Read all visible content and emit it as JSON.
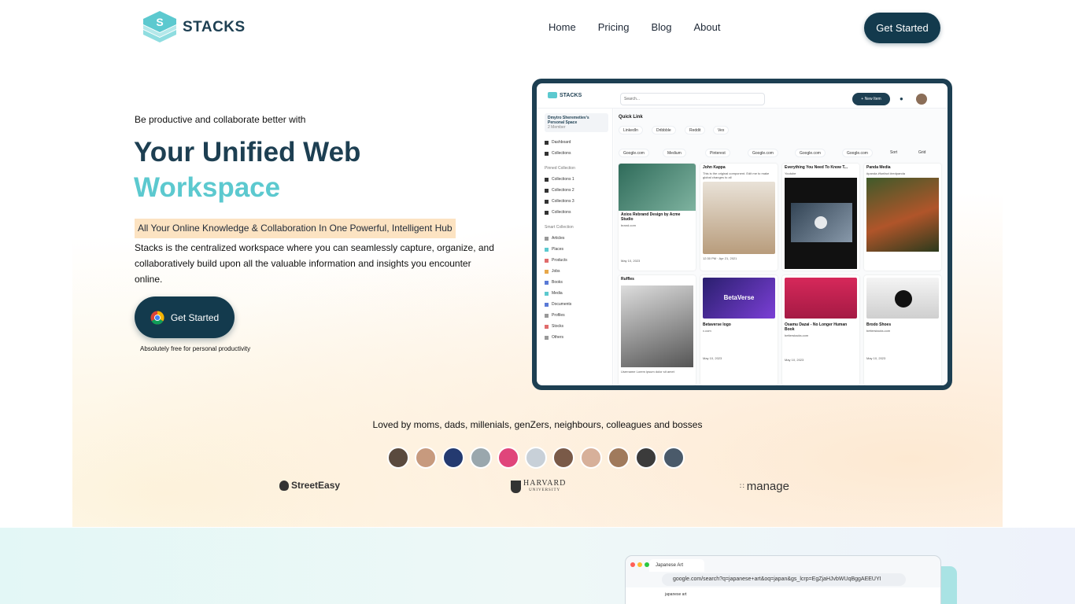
{
  "header": {
    "logo_text": "STACKS",
    "nav": [
      "Home",
      "Pricing",
      "Blog",
      "About"
    ],
    "cta": "Get Started"
  },
  "hero": {
    "tagline": "Be productive and collaborate better with",
    "title_line1": "Your Unified Web",
    "title_line2": "Workspace",
    "highlight": "All Your Online Knowledge & Collaboration In One Powerful, Intelligent Hub",
    "description": "Stacks is the centralized workspace where you can seamlessly capture, organize, and collaboratively build upon all the valuable information and insights you encounter online.",
    "cta": "Get Started",
    "cta_note": "Absolutely free for personal productivity"
  },
  "mock": {
    "logo": "STACKS",
    "search_placeholder": "Search...",
    "new_item": "+ New Item",
    "space_name": "Dmytro Sheremetiev's Personal Space",
    "space_members": "2 Member",
    "sidebar": [
      "Dashboard",
      "Collections"
    ],
    "pinned_title": "Pinned Collection",
    "pinned": [
      "Collections 1",
      "Collections 2",
      "Collections 3",
      "Collections"
    ],
    "smart_title": "Smart Collection",
    "smart": [
      "Articles",
      "Places",
      "Products",
      "Jobs",
      "Books",
      "Media",
      "Documents",
      "Profiles",
      "Stocks",
      "Others"
    ],
    "quick_link": "Quick Link",
    "quick_links": [
      "LinkedIn",
      "Dribbble",
      "Reddit",
      "Vex"
    ],
    "filters": [
      "Google.com",
      "Medium",
      "Pinterest",
      "Google.com",
      "Google.com",
      "Google.com"
    ],
    "sort": "Sort",
    "grid": "Grid",
    "cards": [
      {
        "title": "Axios Rebrand Design by Acme Studio",
        "sub": "brand.com",
        "date": "May 10, 2023"
      },
      {
        "title": "John Kappa",
        "sub": "This is the original component. Edit me to make global changes to all",
        "date": "12:30 PM · Apr 21, 2021"
      },
      {
        "title": "Everything You Need To Know T...",
        "sub": "Youtube",
        "date": ""
      },
      {
        "title": "Panda Media",
        "sub": "#panda #funfact #redpanda",
        "date": ""
      },
      {
        "title": "Ruffles",
        "sub": "Username Lorem ipsum dolor sit amet",
        "date": ""
      },
      {
        "title": "Betaverse logo",
        "sub": "x.com",
        "date": "May 10, 2023"
      },
      {
        "title": "Osamu Dazai - No Longer Human Book",
        "sub": "betterstacks.com",
        "date": "May 10, 2023"
      },
      {
        "title": "Brodo Shoes",
        "sub": "betterstacks.com",
        "date": "May 10, 2023"
      }
    ],
    "betaverse_label": "BetaVerse"
  },
  "social": {
    "loved_by": "Loved by moms, dads, millenials, genZers, neighbours, colleagues and bosses",
    "avatar_colors": [
      "#5a4a3e",
      "#c79a7e",
      "#243a70",
      "#9aa7ad",
      "#e0457b",
      "#c8d0d8",
      "#7a5a48",
      "#d7b09a",
      "#a07a5c",
      "#3b3b3b",
      "#4a5a6a"
    ],
    "brands": [
      "StreetEasy",
      "HARVARD",
      "manage"
    ],
    "harvard_sub": "UNIVERSITY"
  },
  "browser": {
    "tab": "Japanese Art",
    "url": "google.com/search?q=japanese+art&oq=japan&gs_lcrp=EgZjaHJvbWUqBggAEEUYI",
    "search_text": "japanese art"
  },
  "colors": {
    "brand_dark": "#133a4d",
    "brand_teal": "#5cc9cf",
    "highlight": "#fce3c2"
  }
}
